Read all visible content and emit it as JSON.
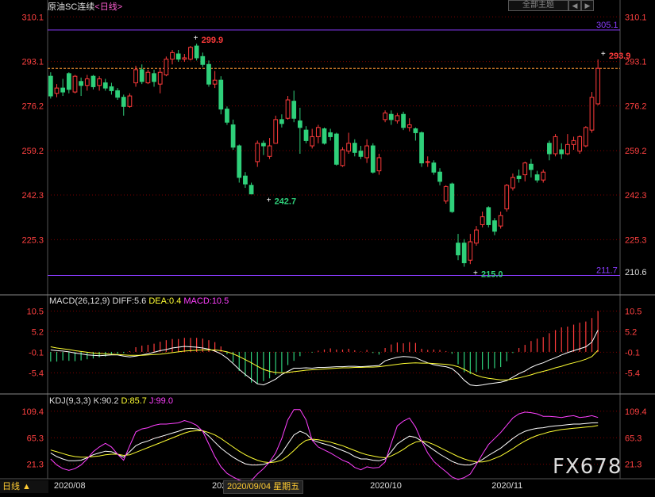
{
  "header": {
    "title": "原油SC连续",
    "period": "<日线>",
    "theme_button": "全部主题",
    "nav_prev": "◀",
    "nav_next": "▶"
  },
  "status": {
    "period_button": "日线 ▲",
    "hover_date": "2020/09/04 星期五"
  },
  "watermark": "FX678",
  "colors": {
    "up": "#ff3b3b",
    "down": "#2fd07a",
    "grid": "#7a0000",
    "axis_text": "#ff4040",
    "hline": "#8a3cff",
    "dash": "#ff9933",
    "diff": "#ffffff",
    "dea": "#ffff33",
    "k": "#ffffff",
    "d": "#ffff33",
    "j": "#ff40ff"
  },
  "chart_data": [
    {
      "type": "candlestick",
      "title": "原油SC连续 <日线>",
      "ylim": [
        205.5,
        313.5
      ],
      "yticks": [
        310.1,
        293.1,
        276.2,
        259.2,
        242.3,
        225.3
      ],
      "xticks": [
        {
          "i": 0,
          "label": "2020/08"
        },
        {
          "i": 26,
          "label": "202"
        },
        {
          "i": 52,
          "label": "2020/10"
        },
        {
          "i": 72,
          "label": "2020/11"
        }
      ],
      "hlines": [
        {
          "value": 305.1,
          "label": "305.1"
        },
        {
          "value": 211.7,
          "label": "211.7"
        }
      ],
      "dashed_line": {
        "value": 290.5,
        "label": "293.1"
      },
      "annotations": [
        {
          "i": 24,
          "value": 299.9,
          "label": "299.9"
        },
        {
          "i": 36,
          "value": 242.7,
          "label": "242.7"
        },
        {
          "i": 70,
          "value": 215.0,
          "label": "215.0"
        },
        {
          "i": 91,
          "value": 293.9,
          "label": "293.9"
        }
      ],
      "extra_label": "210.6",
      "candles": [
        [
          0,
          287.5,
          280.0,
          289.0,
          279.0
        ],
        [
          1,
          281.0,
          283.0,
          284.5,
          279.5
        ],
        [
          2,
          283.0,
          281.5,
          286.5,
          280.0
        ],
        [
          3,
          288.5,
          282.5,
          289.0,
          281.0
        ],
        [
          4,
          281.5,
          287.5,
          288.0,
          281.0
        ],
        [
          5,
          285.5,
          284.0,
          287.0,
          280.0
        ],
        [
          6,
          284.0,
          286.5,
          288.0,
          282.0
        ],
        [
          7,
          287.5,
          283.5,
          288.0,
          282.5
        ],
        [
          8,
          284.0,
          286.5,
          287.5,
          282.0
        ],
        [
          9,
          285.0,
          283.0,
          286.5,
          282.0
        ],
        [
          10,
          283.5,
          282.0,
          285.0,
          280.5
        ],
        [
          11,
          282.0,
          279.5,
          283.0,
          278.5
        ],
        [
          12,
          279.5,
          276.0,
          280.5,
          272.5
        ],
        [
          13,
          276.0,
          280.0,
          281.0,
          275.5
        ],
        [
          14,
          285.0,
          290.0,
          291.5,
          283.5
        ],
        [
          15,
          290.0,
          285.5,
          292.0,
          284.5
        ],
        [
          16,
          285.0,
          289.0,
          290.0,
          284.5
        ],
        [
          17,
          288.5,
          285.5,
          290.0,
          283.5
        ],
        [
          18,
          284.5,
          289.0,
          290.5,
          281.0
        ],
        [
          19,
          288.0,
          294.0,
          295.0,
          287.5
        ],
        [
          20,
          294.0,
          296.5,
          297.5,
          292.0
        ],
        [
          21,
          296.0,
          294.0,
          297.5,
          293.0
        ],
        [
          22,
          294.0,
          294.5,
          296.0,
          293.0
        ],
        [
          23,
          294.0,
          298.5,
          299.0,
          293.5
        ],
        [
          24,
          299.0,
          294.5,
          299.9,
          293.5
        ],
        [
          25,
          295.0,
          292.0,
          296.5,
          291.0
        ],
        [
          26,
          292.0,
          284.5,
          293.5,
          283.5
        ],
        [
          27,
          284.5,
          286.0,
          289.5,
          283.0
        ],
        [
          28,
          286.0,
          275.0,
          287.5,
          273.0
        ],
        [
          29,
          275.0,
          270.0,
          276.0,
          269.0
        ],
        [
          30,
          269.0,
          260.5,
          271.0,
          259.5
        ],
        [
          31,
          261.0,
          249.0,
          261.5,
          247.0
        ],
        [
          32,
          249.5,
          246.5,
          251.0,
          245.0
        ],
        [
          33,
          246.0,
          242.7,
          247.0,
          242.7
        ],
        [
          34,
          255.0,
          262.0,
          263.0,
          253.0
        ],
        [
          35,
          262.0,
          261.0,
          263.0,
          257.5
        ],
        [
          36,
          257.0,
          261.0,
          264.0,
          256.0
        ],
        [
          37,
          262.0,
          271.0,
          272.5,
          262.0
        ],
        [
          38,
          271.0,
          269.5,
          273.0,
          268.0
        ],
        [
          39,
          271.5,
          278.5,
          280.0,
          271.0
        ],
        [
          40,
          278.0,
          271.5,
          282.0,
          270.0
        ],
        [
          41,
          270.5,
          268.0,
          275.5,
          258.0
        ],
        [
          42,
          267.0,
          263.0,
          268.5,
          262.0
        ],
        [
          43,
          261.0,
          264.5,
          267.5,
          260.0
        ],
        [
          44,
          264.5,
          268.0,
          269.0,
          262.0
        ],
        [
          45,
          267.5,
          262.0,
          268.0,
          261.5
        ],
        [
          46,
          266.0,
          264.5,
          267.5,
          263.0
        ],
        [
          47,
          265.5,
          254.0,
          266.0,
          253.5
        ],
        [
          48,
          253.5,
          259.5,
          260.5,
          253.0
        ],
        [
          49,
          259.0,
          262.0,
          266.0,
          258.0
        ],
        [
          50,
          262.0,
          258.5,
          263.5,
          257.0
        ],
        [
          51,
          259.0,
          257.0,
          261.0,
          256.0
        ],
        [
          52,
          256.5,
          261.0,
          263.5,
          254.5
        ],
        [
          53,
          261.0,
          251.0,
          262.0,
          250.5
        ],
        [
          54,
          251.5,
          256.5,
          258.0,
          250.0
        ],
        [
          55,
          271.0,
          273.5,
          274.5,
          270.0
        ],
        [
          56,
          273.0,
          271.0,
          274.5,
          269.0
        ],
        [
          57,
          270.5,
          272.5,
          273.5,
          269.5
        ],
        [
          58,
          273.0,
          268.0,
          274.0,
          267.0
        ],
        [
          59,
          268.0,
          269.0,
          271.5,
          266.5
        ],
        [
          60,
          267.5,
          266.0,
          268.0,
          263.0
        ],
        [
          61,
          266.0,
          254.5,
          266.5,
          253.0
        ],
        [
          62,
          255.0,
          255.0,
          257.0,
          253.0
        ],
        [
          63,
          254.5,
          251.0,
          255.5,
          250.0
        ],
        [
          64,
          251.0,
          247.5,
          252.5,
          246.0
        ],
        [
          65,
          240.0,
          245.5,
          246.0,
          239.0
        ],
        [
          66,
          246.5,
          236.0,
          247.0,
          235.5
        ],
        [
          67,
          224.0,
          219.5,
          227.5,
          217.5
        ],
        [
          68,
          224.0,
          216.5,
          225.5,
          215.0
        ],
        [
          69,
          217.5,
          224.5,
          227.5,
          216.0
        ],
        [
          70,
          224.0,
          229.0,
          230.5,
          223.0
        ],
        [
          71,
          231.0,
          234.0,
          236.0,
          230.0
        ],
        [
          72,
          237.5,
          231.0,
          238.0,
          230.0
        ],
        [
          73,
          232.5,
          228.5,
          233.5,
          227.0
        ],
        [
          74,
          230.5,
          234.5,
          236.0,
          229.5
        ],
        [
          75,
          237.0,
          246.0,
          246.5,
          236.0
        ],
        [
          76,
          245.0,
          249.0,
          250.5,
          244.0
        ],
        [
          77,
          249.5,
          248.5,
          252.0,
          247.0
        ],
        [
          78,
          250.0,
          254.5,
          255.0,
          247.5
        ],
        [
          79,
          254.0,
          252.0,
          256.0,
          249.0
        ],
        [
          80,
          250.0,
          248.0,
          251.5,
          247.0
        ],
        [
          81,
          248.0,
          251.0,
          252.0,
          247.0
        ],
        [
          82,
          262.0,
          258.0,
          263.0,
          255.5
        ],
        [
          83,
          258.0,
          264.5,
          265.5,
          257.0
        ],
        [
          84,
          259.5,
          258.0,
          262.0,
          256.0
        ],
        [
          85,
          258.0,
          261.5,
          265.5,
          257.5
        ],
        [
          86,
          261.5,
          263.0,
          264.5,
          259.5
        ],
        [
          87,
          259.0,
          264.5,
          265.0,
          258.0
        ],
        [
          88,
          261.0,
          268.0,
          268.5,
          260.5
        ],
        [
          89,
          267.0,
          279.5,
          281.5,
          266.0
        ],
        [
          90,
          277.0,
          290.5,
          293.9,
          276.5
        ]
      ]
    },
    {
      "type": "bar+line",
      "title": "MACD(26,12,9)",
      "labels": {
        "title": "MACD(26,12,9)",
        "diff": "DIFF:5.6",
        "dea": "DEA:0.4",
        "macd": "MACD:10.5"
      },
      "ylim": [
        -10,
        12
      ],
      "yticks": [
        10.5,
        5.2,
        -0.1,
        -5.4
      ],
      "macd": [
        -2.5,
        -2.5,
        -2.2,
        -2.3,
        -2.4,
        -2.2,
        -1.9,
        -1.7,
        -1.4,
        -1.2,
        -0.8,
        -0.5,
        -0.3,
        0.2,
        1.2,
        1.6,
        1.8,
        2.1,
        2.6,
        3.0,
        3.3,
        3.3,
        3.6,
        3.6,
        3.6,
        3.4,
        3.0,
        2.5,
        1.4,
        -0.6,
        -2.7,
        -4.9,
        -6.3,
        -7.9,
        -8.3,
        -7.5,
        -6.8,
        -5.9,
        -5.2,
        -3.4,
        -2.3,
        -1.1,
        0.0,
        -0.2,
        0.3,
        0.6,
        0.9,
        0.6,
        0.6,
        0.8,
        0.4,
        0.1,
        0.5,
        -0.3,
        -0.7,
        1.0,
        1.9,
        2.4,
        2.2,
        2.5,
        2.3,
        0.8,
        0.5,
        0.6,
        0.5,
        0.2,
        -0.5,
        -3.2,
        -5.2,
        -5.7,
        -5.2,
        -4.6,
        -4.4,
        -4.2,
        -3.9,
        -2.4,
        -0.3,
        1.0,
        1.8,
        2.8,
        3.4,
        3.8,
        4.8,
        5.6,
        6.3,
        6.5,
        7.0,
        7.5,
        7.8,
        8.7,
        10.5
      ],
      "diff": [
        0.5,
        0.3,
        0.2,
        0.0,
        -0.3,
        -0.5,
        -0.8,
        -0.9,
        -1.0,
        -0.9,
        -0.8,
        -0.8,
        -1.1,
        -1.3,
        -1.1,
        -0.8,
        -0.5,
        -0.1,
        0.3,
        0.6,
        1.0,
        1.2,
        1.4,
        1.3,
        1.2,
        1.0,
        0.7,
        0.2,
        -0.5,
        -1.6,
        -3.0,
        -4.5,
        -5.8,
        -7.0,
        -8.2,
        -8.5,
        -7.8,
        -7.0,
        -5.8,
        -5.0,
        -4.2,
        -4.2,
        -4.1,
        -4.2,
        -4.0,
        -4.0,
        -3.9,
        -3.8,
        -3.8,
        -3.7,
        -3.7,
        -3.8,
        -3.7,
        -3.6,
        -3.5,
        -2.3,
        -1.8,
        -1.4,
        -1.2,
        -1.3,
        -1.5,
        -2.2,
        -2.8,
        -3.3,
        -3.6,
        -3.8,
        -4.3,
        -5.6,
        -7.3,
        -8.5,
        -8.7,
        -8.5,
        -8.2,
        -8.0,
        -7.8,
        -7.4,
        -6.5,
        -5.6,
        -4.9,
        -4.0,
        -3.3,
        -2.8,
        -2.1,
        -1.5,
        -0.8,
        -0.2,
        0.3,
        0.8,
        1.3,
        2.5,
        5.6
      ],
      "dea": [
        1.3,
        1.0,
        0.8,
        0.6,
        0.3,
        0.1,
        -0.1,
        -0.3,
        -0.4,
        -0.5,
        -0.6,
        -0.7,
        -0.8,
        -0.9,
        -0.9,
        -0.9,
        -0.8,
        -0.7,
        -0.6,
        -0.4,
        -0.2,
        0.0,
        0.2,
        0.3,
        0.4,
        0.5,
        0.5,
        0.5,
        0.3,
        0.0,
        -0.5,
        -1.2,
        -2.0,
        -2.8,
        -3.7,
        -4.5,
        -5.0,
        -5.3,
        -5.4,
        -5.3,
        -5.1,
        -4.9,
        -4.7,
        -4.6,
        -4.5,
        -4.4,
        -4.3,
        -4.2,
        -4.1,
        -4.1,
        -4.0,
        -4.0,
        -3.9,
        -3.9,
        -3.8,
        -3.6,
        -3.4,
        -3.2,
        -3.0,
        -2.9,
        -2.8,
        -2.9,
        -2.9,
        -3.0,
        -3.1,
        -3.2,
        -3.4,
        -3.8,
        -4.5,
        -5.3,
        -6.0,
        -6.5,
        -6.8,
        -7.0,
        -7.2,
        -7.2,
        -7.0,
        -6.7,
        -6.3,
        -5.9,
        -5.4,
        -5.0,
        -4.6,
        -4.1,
        -3.7,
        -3.2,
        -2.8,
        -2.4,
        -1.9,
        -1.2,
        0.4
      ]
    },
    {
      "type": "line",
      "title": "KDJ(9,3,3)",
      "labels": {
        "title": "KDJ(9,3,3)",
        "k": "K:90.2",
        "d": "D:85.7",
        "j": "J:99.0"
      },
      "ylim": [
        5,
        121
      ],
      "yticks": [
        109.4,
        65.3,
        21.3
      ],
      "k": [
        40,
        34,
        30,
        27,
        27,
        28,
        32,
        37,
        40,
        43,
        42,
        38,
        33,
        42,
        52,
        57,
        60,
        64,
        67,
        70,
        73,
        76,
        80,
        81,
        80,
        77,
        68,
        58,
        48,
        40,
        33,
        27,
        22,
        20,
        20,
        21,
        24,
        30,
        40,
        55,
        70,
        76,
        72,
        62,
        58,
        55,
        52,
        48,
        44,
        40,
        34,
        30,
        30,
        28,
        27,
        30,
        42,
        55,
        62,
        68,
        66,
        60,
        52,
        45,
        38,
        32,
        26,
        22,
        20,
        20,
        24,
        29,
        36,
        42,
        48,
        56,
        64,
        71,
        76,
        79,
        81,
        82,
        84,
        85,
        86,
        87,
        88,
        88,
        89,
        90,
        90.2
      ],
      "d": [
        45,
        42,
        39,
        36,
        34,
        33,
        33,
        34,
        35,
        37,
        38,
        38,
        36,
        37,
        41,
        45,
        49,
        53,
        57,
        61,
        65,
        69,
        73,
        76,
        77,
        77,
        74,
        70,
        64,
        57,
        50,
        43,
        37,
        32,
        28,
        25,
        24,
        25,
        28,
        35,
        44,
        54,
        61,
        63,
        62,
        60,
        58,
        55,
        52,
        48,
        44,
        40,
        37,
        35,
        33,
        32,
        35,
        40,
        46,
        53,
        58,
        60,
        58,
        54,
        49,
        44,
        39,
        34,
        30,
        27,
        25,
        25,
        27,
        31,
        35,
        41,
        47,
        54,
        60,
        65,
        69,
        72,
        75,
        77,
        79,
        80,
        81,
        82,
        83,
        84,
        85.7
      ],
      "j": [
        30,
        20,
        14,
        11,
        14,
        20,
        30,
        42,
        50,
        56,
        50,
        38,
        28,
        52,
        75,
        80,
        82,
        86,
        88,
        88,
        89,
        90,
        94,
        91,
        86,
        76,
        55,
        34,
        17,
        6,
        0,
        -5,
        -8,
        -6,
        5,
        14,
        25,
        40,
        64,
        95,
        112,
        112,
        95,
        61,
        50,
        45,
        40,
        34,
        28,
        24,
        16,
        12,
        17,
        15,
        16,
        25,
        56,
        85,
        93,
        98,
        83,
        60,
        40,
        26,
        17,
        9,
        0,
        -4,
        -1,
        5,
        21,
        38,
        54,
        64,
        74,
        86,
        98,
        105,
        108,
        107,
        105,
        101,
        101,
        100,
        99,
        101,
        102,
        99,
        100,
        102,
        99.0
      ]
    }
  ]
}
